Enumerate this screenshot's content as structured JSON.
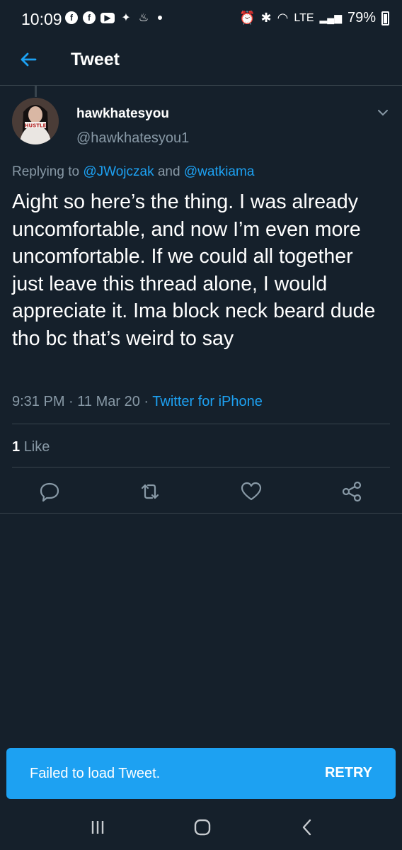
{
  "status_bar": {
    "time": "10:09",
    "network": "LTE",
    "battery": "79%"
  },
  "header": {
    "title": "Tweet"
  },
  "tweet": {
    "display_name": "hawkhatesyou",
    "handle": "@hawkhatesyou1",
    "replying_prefix": "Replying to",
    "reply_to_1": "@JWojczak",
    "reply_and": "and",
    "reply_to_2": "@watkiama",
    "text": "Aight so here’s the thing. I was already uncomfortable, and now I’m even more uncomfortable. If we could all together just leave this thread alone, I would appreciate it. Ima block neck beard dude tho bc that’s weird to say",
    "time": "9:31 PM",
    "date": "11 Mar 20",
    "source": "Twitter for iPhone",
    "like_count": "1",
    "like_label": "Like",
    "avatar_shirt_text": "HUSTLE"
  },
  "toast": {
    "message": "Failed to load Tweet.",
    "action": "RETRY"
  },
  "colors": {
    "background": "#15202b",
    "accent": "#1da1f2",
    "secondary_text": "#8899a6",
    "divider": "#38444d"
  },
  "icons": [
    "back-arrow-icon",
    "chevron-down-icon",
    "reply-icon",
    "retweet-icon",
    "like-icon",
    "share-icon",
    "recents-icon",
    "home-icon",
    "nav-back-icon"
  ]
}
